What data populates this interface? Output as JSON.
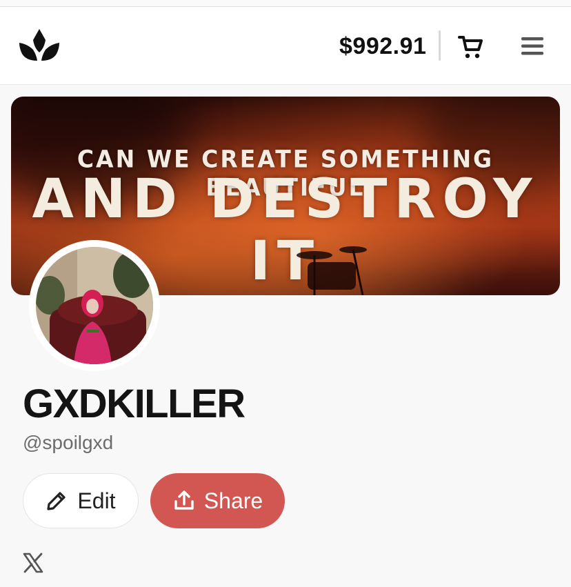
{
  "header": {
    "balance": "$992.91",
    "logo_icon": "crown-lotus-logo-icon",
    "cart_icon": "cart-icon",
    "menu_icon": "hamburger-menu-icon"
  },
  "banner": {
    "line1": "CAN WE CREATE SOMETHING BEAUTIFUL",
    "line2": "AND DESTROY IT"
  },
  "profile": {
    "display_name": "GXDKILLER",
    "handle": "@spoilgxd"
  },
  "actions": {
    "edit_label": "Edit",
    "share_label": "Share",
    "edit_icon": "pencil-icon",
    "share_icon": "share-upload-icon"
  },
  "socials": {
    "x_icon": "x-twitter-icon"
  },
  "colors": {
    "share_button": "#d25752",
    "text_primary": "#141414",
    "text_secondary": "#6c6c6c"
  }
}
